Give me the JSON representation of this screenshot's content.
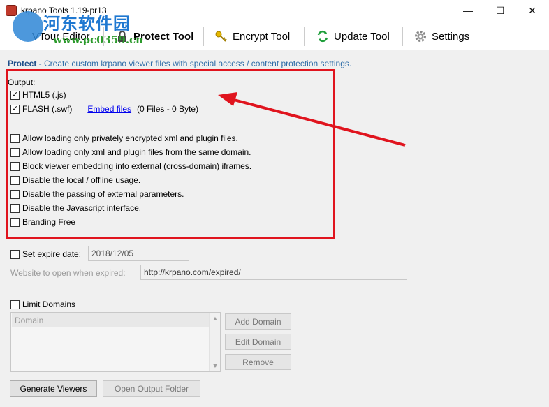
{
  "window": {
    "title": "krpano Tools 1.19-pr13",
    "minimize_glyph": "—",
    "maximize_glyph": "☐",
    "close_glyph": "✕"
  },
  "watermark": {
    "text": "河东软件园",
    "url": "www.pc0359.cn"
  },
  "tabs": [
    {
      "label": "VTour Editor",
      "icon": "tour-editor-icon",
      "active": false
    },
    {
      "label": "Protect Tool",
      "icon": "lock-icon",
      "active": true
    },
    {
      "label": "Encrypt Tool",
      "icon": "key-icon",
      "active": false
    },
    {
      "label": "Update Tool",
      "icon": "refresh-icon",
      "active": false
    },
    {
      "label": "Settings",
      "icon": "gear-icon",
      "active": false
    }
  ],
  "header": {
    "section": "Protect",
    "description": " - Create custom krpano viewer files with special access / content protection settings."
  },
  "output": {
    "label": "Output:",
    "html5": {
      "label": "HTML5 (.js)",
      "checked": true
    },
    "flash": {
      "label": "FLASH (.swf)",
      "checked": true
    },
    "embed_link": "Embed files",
    "embed_info": "(0 Files - 0 Byte)"
  },
  "options": [
    {
      "label": "Allow loading only privately encrypted xml and plugin files.",
      "checked": false
    },
    {
      "label": "Allow loading only xml and plugin files from the same domain.",
      "checked": false
    },
    {
      "label": "Block viewer embedding into external (cross-domain) iframes.",
      "checked": false
    },
    {
      "label": "Disable the local / offline usage.",
      "checked": false
    },
    {
      "label": "Disable the passing of external parameters.",
      "checked": false
    },
    {
      "label": "Disable the Javascript interface.",
      "checked": false
    },
    {
      "label": "Branding Free",
      "checked": false
    }
  ],
  "expire": {
    "label": "Set expire date:",
    "checked": false,
    "date": "2018/12/05",
    "website_label": "Website to open when expired:",
    "website_value": "http://krpano.com/expired/"
  },
  "domains": {
    "label": "Limit Domains",
    "checked": false,
    "column_header": "Domain",
    "add_label": "Add Domain",
    "edit_label": "Edit Domain",
    "remove_label": "Remove"
  },
  "footer": {
    "generate_label": "Generate Viewers",
    "open_folder_label": "Open Output Folder"
  },
  "colors": {
    "highlight_box": "#e0141e",
    "header_text": "#2f6da8"
  }
}
